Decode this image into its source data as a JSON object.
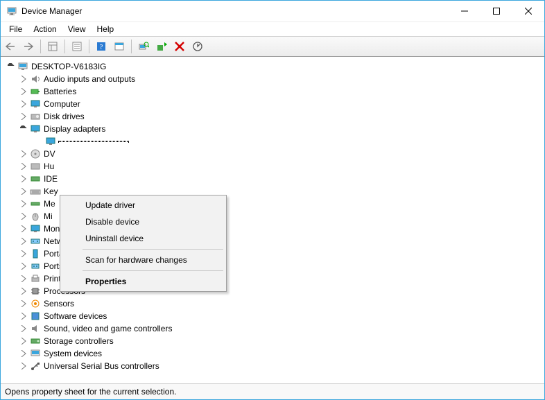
{
  "titlebar": {
    "title": "Device Manager"
  },
  "menubar": {
    "file": "File",
    "action": "Action",
    "view": "View",
    "help": "Help"
  },
  "tree": {
    "root": "DESKTOP-V6183IG",
    "nodes": {
      "audio": "Audio inputs and outputs",
      "batteries": "Batteries",
      "computer": "Computer",
      "disk": "Disk drives",
      "display": "Display adapters",
      "display_child": "",
      "dvd": "DV",
      "hid": "Hu",
      "ide": "IDE",
      "keyboards": "Key",
      "memory": "Me",
      "mice": "Mi",
      "monitors": "Monitors",
      "network": "Network adapters",
      "portable": "Portable Devices",
      "ports": "Ports (COM & LPT)",
      "printq": "Print queues",
      "processors": "Processors",
      "sensors": "Sensors",
      "software": "Software devices",
      "sound": "Sound, video and game controllers",
      "storage": "Storage controllers",
      "sysdev": "System devices",
      "usb": "Universal Serial Bus controllers"
    }
  },
  "context_menu": {
    "update": "Update driver",
    "disable": "Disable device",
    "uninstall": "Uninstall device",
    "scan": "Scan for hardware changes",
    "properties": "Properties"
  },
  "statusbar": {
    "text": "Opens property sheet for the current selection."
  }
}
